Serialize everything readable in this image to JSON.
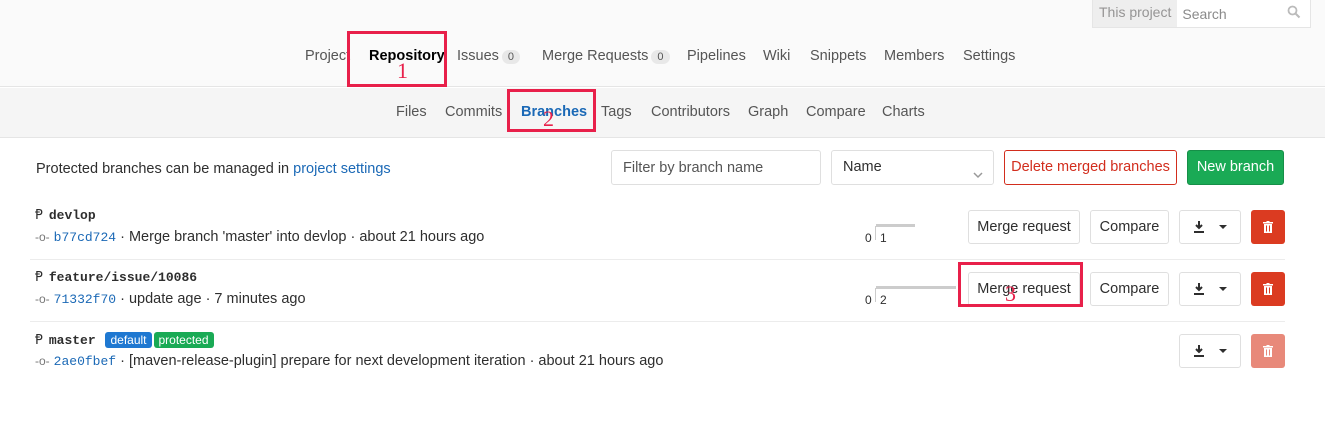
{
  "search": {
    "scope": "This project",
    "placeholder": "Search"
  },
  "nav": {
    "project": "Project",
    "repository": "Repository",
    "issues": "Issues",
    "issues_count": "0",
    "merge_requests": "Merge Requests",
    "merge_requests_count": "0",
    "pipelines": "Pipelines",
    "wiki": "Wiki",
    "snippets": "Snippets",
    "members": "Members",
    "settings": "Settings"
  },
  "subnav": {
    "files": "Files",
    "commits": "Commits",
    "branches": "Branches",
    "tags": "Tags",
    "contributors": "Contributors",
    "graph": "Graph",
    "compare": "Compare",
    "charts": "Charts"
  },
  "annotations": {
    "one": "1",
    "two": "2",
    "three": "3",
    "color": "#e8204a"
  },
  "toolbar": {
    "message": "Protected branches can be managed in ",
    "link": "project settings",
    "filter_placeholder": "Filter by branch name",
    "sort_value": "Name",
    "delete_merged": "Delete merged branches",
    "new_branch": "New branch"
  },
  "branches": [
    {
      "name": "devlop",
      "sha": "b77cd724",
      "message": " · Merge branch 'master' into devlop · about 21 hours ago",
      "behind": "0",
      "ahead": "1",
      "merge_request": "Merge request",
      "compare": "Compare"
    },
    {
      "name": "feature/issue/10086",
      "sha": "71332f70",
      "message": " · update age · 7 minutes ago",
      "behind": "0",
      "ahead": "2",
      "merge_request": "Merge request",
      "compare": "Compare"
    },
    {
      "name": "master",
      "label_default": "default",
      "label_protected": "protected",
      "sha": "2ae0fbef",
      "message": " · [maven-release-plugin] prepare for next development iteration · about 21 hours ago"
    }
  ],
  "colors": {
    "link": "#1b69b6",
    "danger": "#d22d1d",
    "success": "#1aaa55"
  }
}
